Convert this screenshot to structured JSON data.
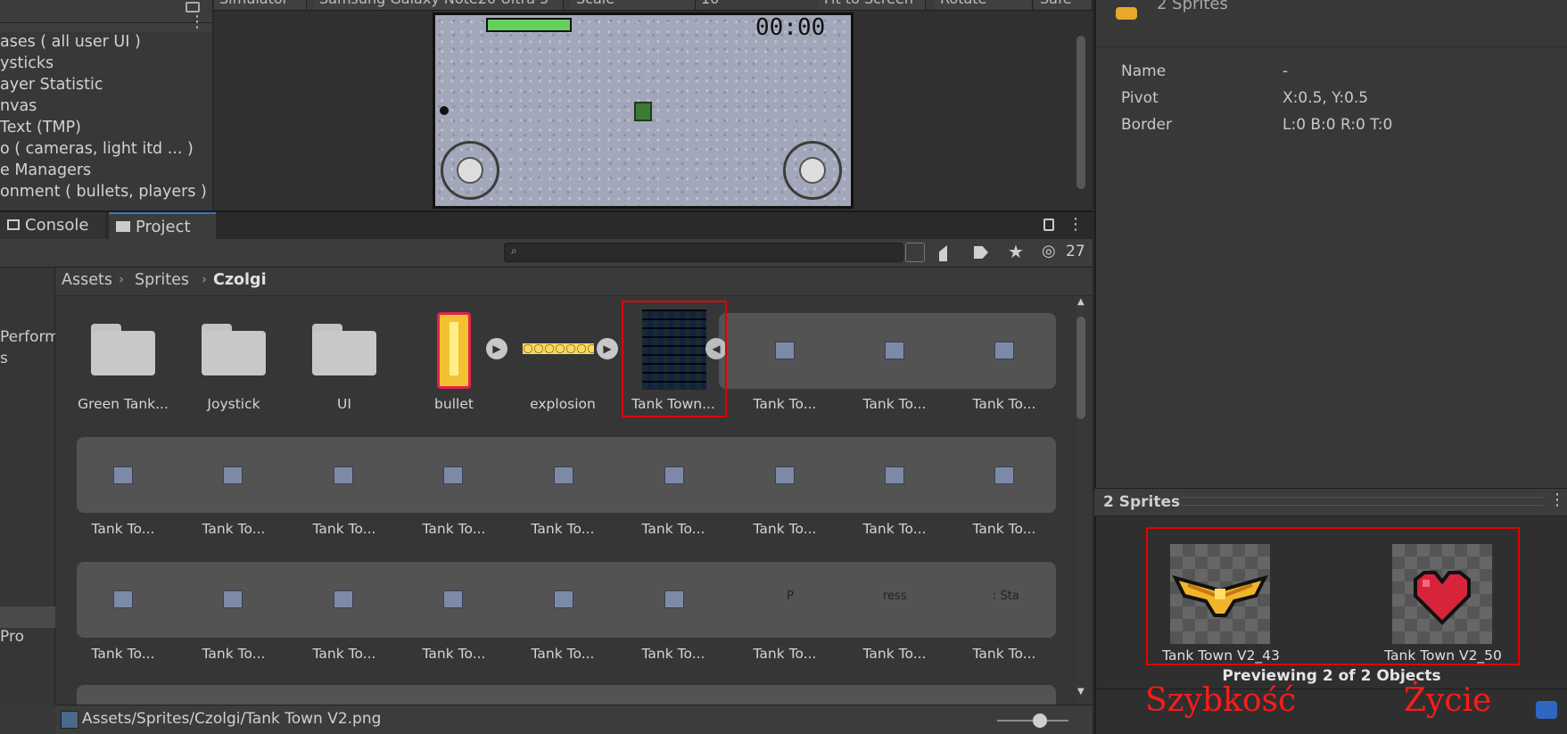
{
  "hierarchy": {
    "items": [
      "ases ( all user UI )",
      "ysticks",
      "ayer Statistic",
      "nvas",
      "Text (TMP)",
      "o ( cameras, light itd ... )",
      "e Managers",
      "onment ( bullets, players )"
    ]
  },
  "simulator": {
    "toolbar": [
      "Simulator",
      "Samsung Galaxy Note20 Ultra 5",
      "Scale",
      "10",
      "Fit to Screen",
      "Rotate",
      "Safe"
    ],
    "timer": "00:00"
  },
  "inspector": {
    "title": "2 Sprites",
    "rows": [
      {
        "label": "Name",
        "value": "-"
      },
      {
        "label": "Pivot",
        "value": "X:0.5, Y:0.5"
      },
      {
        "label": "Border",
        "value": "L:0 B:0 R:0 T:0"
      }
    ]
  },
  "preview": {
    "header": "2 Sprites",
    "items": [
      "Tank Town V2_43",
      "Tank Town V2_50"
    ],
    "caption": "Previewing 2 of 2 Objects"
  },
  "annotations": {
    "left": "Szybkość",
    "right": "Życie"
  },
  "project": {
    "tabs": {
      "console": "Console",
      "project": "Project"
    },
    "hidden_count": "27",
    "breadcrumb": [
      "Assets",
      "Sprites",
      "Czolgi"
    ],
    "left_labels": [
      "Perform",
      "s",
      "Pro"
    ],
    "row1": [
      "Green Tank...",
      "Joystick",
      "UI",
      "bullet",
      "explosion",
      "Tank Town...",
      "Tank To...",
      "Tank To...",
      "Tank To..."
    ],
    "row2": [
      "Tank To...",
      "Tank To...",
      "Tank To...",
      "Tank To...",
      "Tank To...",
      "Tank To...",
      "Tank To...",
      "Tank To...",
      "Tank To..."
    ],
    "row3": [
      "Tank To...",
      "Tank To...",
      "Tank To...",
      "Tank To...",
      "Tank To...",
      "Tank To...",
      "Tank To...",
      "Tank To...",
      "Tank To..."
    ],
    "row3_thumb_text": [
      "P",
      "ress",
      ": Sta"
    ],
    "status_path": "Assets/Sprites/Czolgi/Tank Town V2.png"
  }
}
